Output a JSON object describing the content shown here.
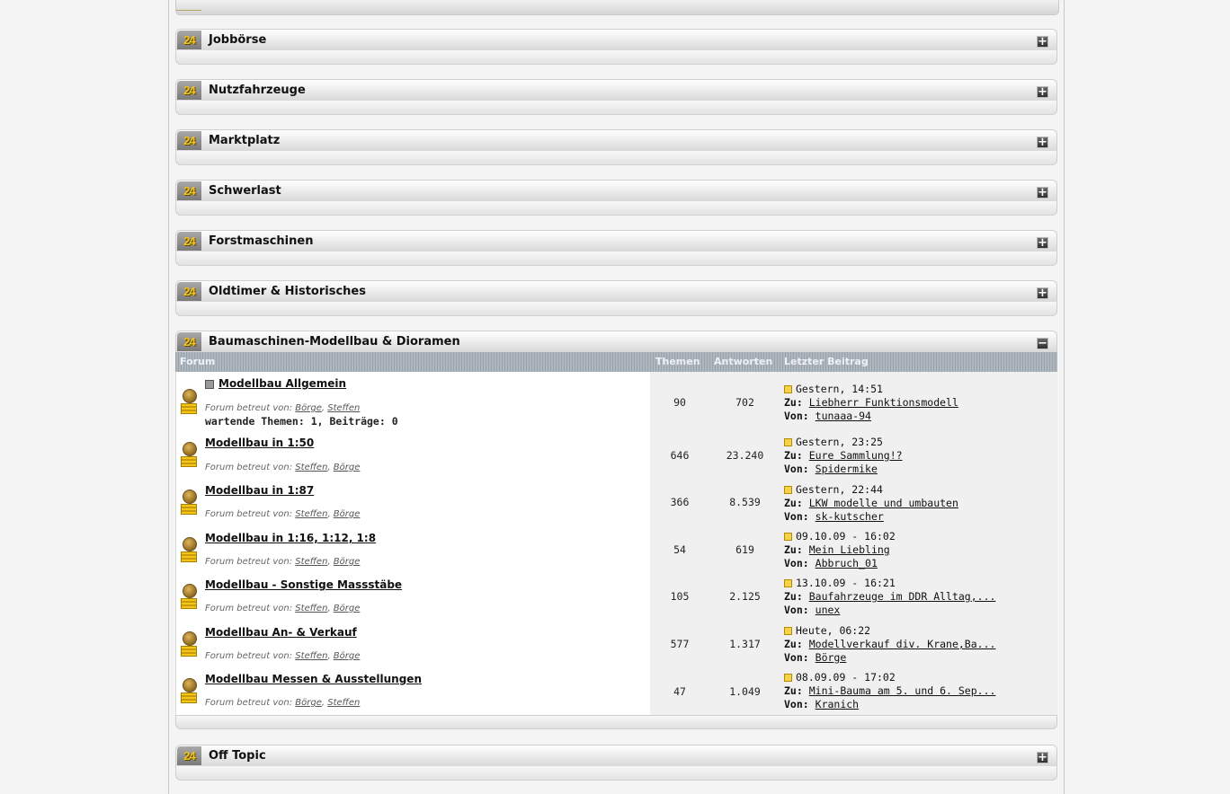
{
  "categories_collapsed": [
    {
      "title": "Jobbörse",
      "badge": "24",
      "toggle": "+"
    },
    {
      "title": "Nutzfahrzeuge",
      "badge": "24",
      "toggle": "+"
    },
    {
      "title": "Marktplatz",
      "badge": "24",
      "toggle": "+"
    },
    {
      "title": "Schwerlast",
      "badge": "24",
      "toggle": "+"
    },
    {
      "title": "Forstmaschinen",
      "badge": "24",
      "toggle": "+"
    },
    {
      "title": "Oldtimer & Historisches",
      "badge": "24",
      "toggle": "+"
    }
  ],
  "open_category": {
    "title": "Baumaschinen-Modellbau & Dioramen",
    "badge": "24",
    "toggle": "−",
    "columns": {
      "forum": "Forum",
      "themen": "Themen",
      "antworten": "Antworten",
      "letzter": "Letzter Beitrag"
    },
    "moderated_by": "Forum betreut von:",
    "to_label": "Zu:",
    "from_label": "Von:",
    "forums": [
      {
        "name": "Modellbau Allgemein",
        "mods": [
          "Börge",
          "Steffen"
        ],
        "waiting": "wartende Themen: 1, Beiträge: 0",
        "themen": "90",
        "antworten": "702",
        "date": "Gestern, 14:51",
        "topic": "Liebherr Funktionsmodell",
        "author": "tunaaa-94"
      },
      {
        "name": "Modellbau in 1:50",
        "mods": [
          "Steffen",
          "Börge"
        ],
        "themen": "646",
        "antworten": "23.240",
        "date": "Gestern, 23:25",
        "topic": "Eure Sammlung!?",
        "author": "Spidermike"
      },
      {
        "name": "Modellbau in 1:87",
        "mods": [
          "Steffen",
          "Börge"
        ],
        "themen": "366",
        "antworten": "8.539",
        "date": "Gestern, 22:44",
        "topic": "LKW modelle und umbauten",
        "author": "sk-kutscher"
      },
      {
        "name": "Modellbau in 1:16, 1:12, 1:8",
        "mods": [
          "Steffen",
          "Börge"
        ],
        "themen": "54",
        "antworten": "619",
        "date": "09.10.09 - 16:02",
        "topic": "Mein Liebling",
        "author": "Abbruch_01"
      },
      {
        "name": "Modellbau - Sonstige Massstäbe",
        "mods": [
          "Steffen",
          "Börge"
        ],
        "themen": "105",
        "antworten": "2.125",
        "date": "13.10.09 - 16:21",
        "topic": "Baufahrzeuge im DDR Alltag,...",
        "author": "unex"
      },
      {
        "name": "Modellbau An- & Verkauf",
        "mods": [
          "Steffen",
          "Börge"
        ],
        "themen": "577",
        "antworten": "1.317",
        "date": "Heute, 06:22",
        "topic": "Modellverkauf div. Krane,Ba...",
        "author": "Börge"
      },
      {
        "name": "Modellbau Messen & Ausstellungen",
        "mods": [
          "Börge",
          "Steffen"
        ],
        "themen": "47",
        "antworten": "1.049",
        "date": "08.09.09 - 17:02",
        "topic": "Mini-Bauma am 5. und 6. Sep...",
        "author": "Kranich"
      }
    ]
  },
  "last_category": {
    "title": "Off Topic",
    "badge": "24",
    "toggle": "+"
  }
}
